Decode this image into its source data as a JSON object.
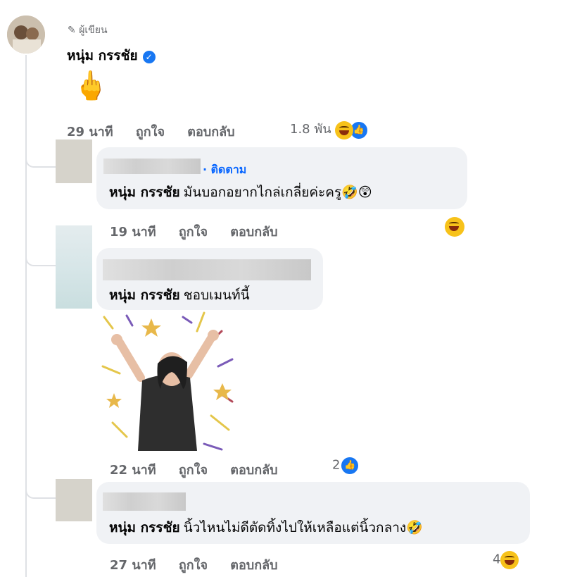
{
  "top_comment": {
    "author_badge": "ผู้เขียน",
    "author_name": "หนุ่ม กรรชัย",
    "verified_icon": "verified-check-icon",
    "content_emoji": "🖕",
    "time": "29 นาที",
    "like_label": "ถูกใจ",
    "reply_label": "ตอบกลับ",
    "reaction_count": "1.8 พัน"
  },
  "replies": [
    {
      "follow_label": "· ติดตาม",
      "mention": "หนุ่ม กรรชัย",
      "text": "มันบอกอยากไกล่เกลี่ยค่ะครู🤣😲",
      "time": "19 นาที",
      "like_label": "ถูกใจ",
      "reply_label": "ตอบกลับ",
      "reaction_count": ""
    },
    {
      "mention": "หนุ่ม กรรชัย",
      "text": "ชอบเมนท์นี้",
      "sticker": "celebrating-woman-sticker",
      "time": "22 นาที",
      "like_label": "ถูกใจ",
      "reply_label": "ตอบกลับ",
      "reaction_count": "2"
    },
    {
      "mention": "หนุ่ม กรรชัย",
      "text": "นิ้วไหนไม่ดีตัดทิ้งไปให้เหลือแต่นิ้วกลาง🤣",
      "time": "27 นาที",
      "like_label": "ถูกใจ",
      "reply_label": "ตอบกลับ",
      "reaction_count": "4"
    }
  ],
  "colors": {
    "link_blue": "#0866ff",
    "meta_gray": "#65676b",
    "bubble": "#f0f2f5"
  }
}
